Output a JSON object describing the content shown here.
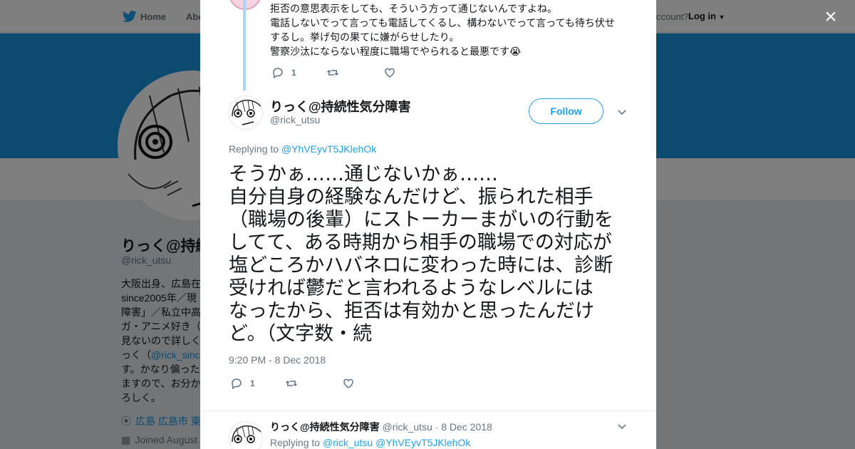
{
  "nav": {
    "home": "Home",
    "about": "Abo",
    "account_prompt": "ccount?",
    "login": "Log in"
  },
  "background_profile": {
    "name": "りっく@持続",
    "handle": "@rick_utsu",
    "bio_lines": [
      "大阪出身、広島在",
      "since2005年／現",
      "障害」／私立中高",
      "ガ・アニメ好き（",
      "見ないので詳しく",
      "っく（",
      "す。かなり偏った",
      "ますので、お分か",
      "ろしく。"
    ],
    "bio_link": "@rick_sinc",
    "location": "広島 広島市 東",
    "joined": "Joined August"
  },
  "close_label": "×",
  "previous_tweet": {
    "lines": [
      "拒否の意思表示をしても、そういう方って通じないんですよね。",
      "電話しないでって言っても電話してくるし、構わないでって言っても待ち伏せ",
      "するし。挙げ句の果てに嫌がらせしたり。",
      "警察沙汰にならない程度に職場でやられると最悪です😭"
    ],
    "reply_count": "1"
  },
  "main_tweet": {
    "name": "りっく@持続性気分障害",
    "handle": "@rick_utsu",
    "follow_label": "Follow",
    "replying_prefix": "Replying to",
    "replying_to": "@YhVEyvT5JKlehOk",
    "text_lines": [
      "そうかぁ……通じないかぁ……",
      "自分自身の経験なんだけど、振られた相手",
      "（職場の後輩）にストーカーまがいの行動を",
      "してて、ある時期から相手の職場での対応が",
      "塩どころかハバネロに変わった時には、診断",
      "受ければ鬱だと言われるようなレベルには",
      "なったから、拒否は有効かと思ったんだけ",
      "ど。（文字数・続"
    ],
    "timestamp": "9:20 PM - 8 Dec 2018",
    "reply_count": "1"
  },
  "next_tweet": {
    "name": "りっく@持続性気分障害",
    "handle": "@rick_utsu",
    "date": "· 8 Dec 2018",
    "replying_prefix": "Replying to",
    "mention1": "@rick_utsu",
    "mention2": "@YhVEyvT5JKlehOk"
  },
  "icons": [
    "twitter-bird-icon",
    "reply-icon",
    "retweet-icon",
    "like-icon",
    "chevron-down-icon",
    "location-icon",
    "calendar-icon",
    "close-icon"
  ],
  "colors": {
    "brand_blue": "#1da1f2",
    "banner_blue": "#1b95e0",
    "thread_line": "#a6d8f7",
    "muted_text": "#657786"
  }
}
